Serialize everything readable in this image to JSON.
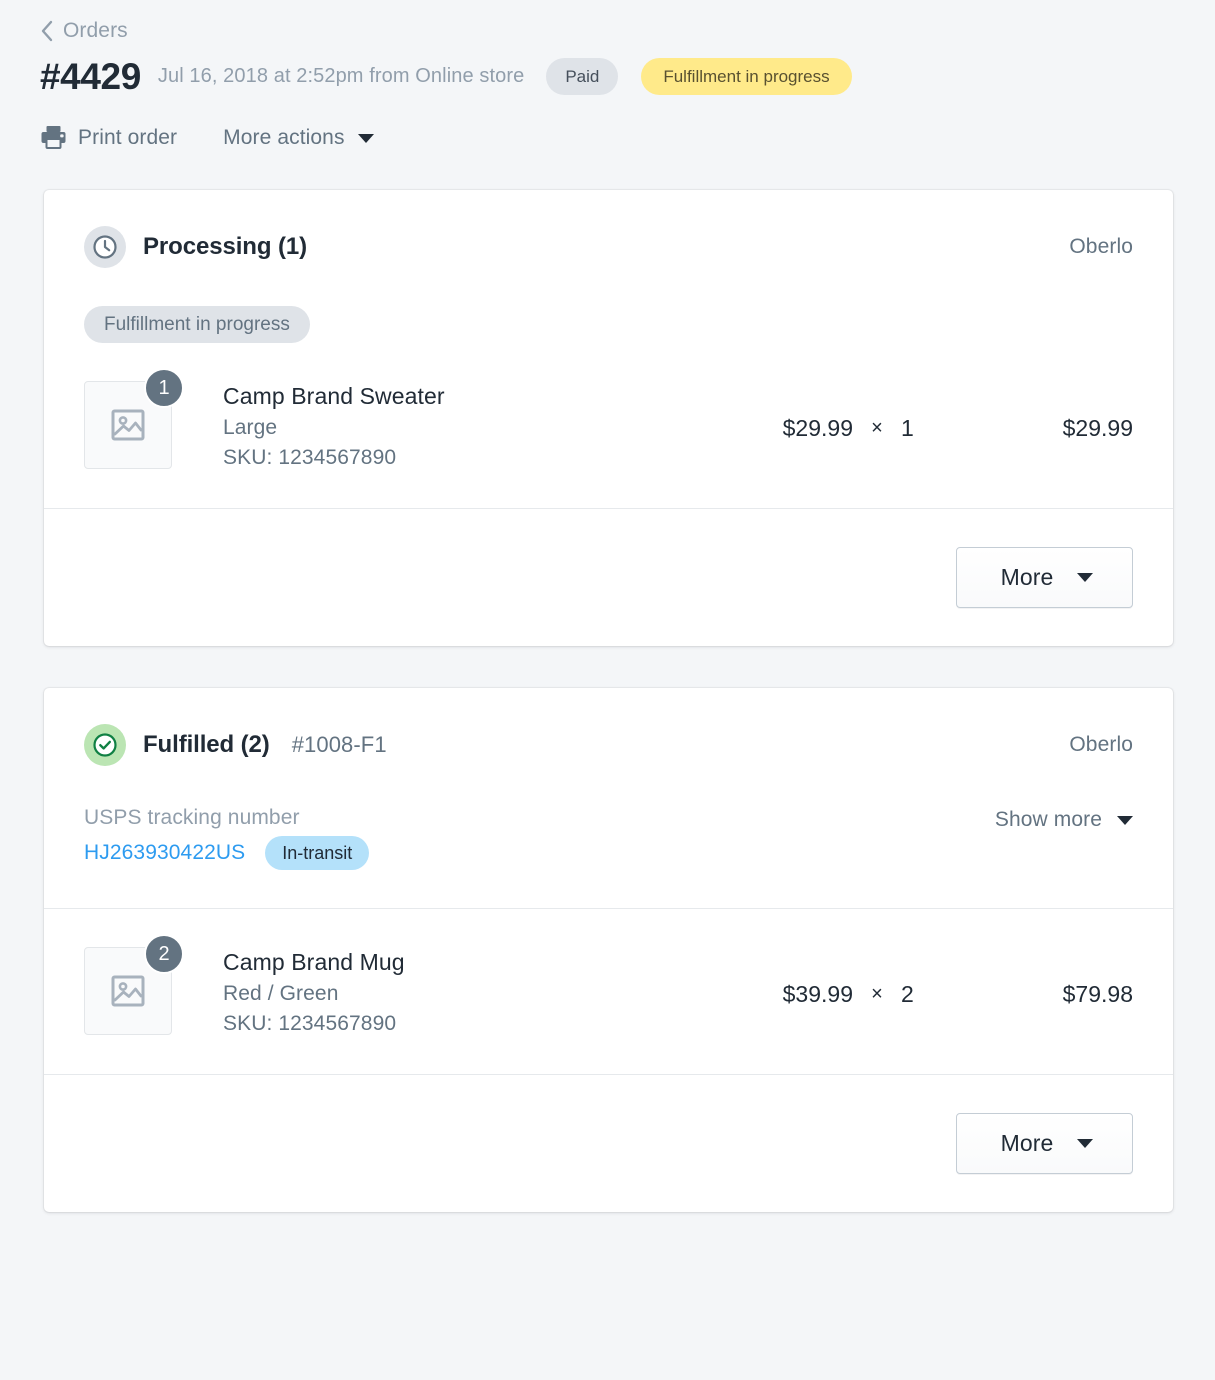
{
  "breadcrumb": {
    "label": "Orders",
    "icon": "chevron-left-icon"
  },
  "header": {
    "order_number": "#4429",
    "meta": "Jul 16, 2018 at 2:52pm from Online store",
    "payment_badge": "Paid",
    "fulfillment_badge": "Fulfillment in progress",
    "payment_badge_bg": "#dfe3e8",
    "fulfillment_badge_bg": "#ffea8a"
  },
  "actions": {
    "print_label": "Print order",
    "print_icon": "printer-icon",
    "more_actions_label": "More actions",
    "more_actions_icon": "caret-down-icon"
  },
  "cards": [
    {
      "id": "processing",
      "status_icon": "clock-icon",
      "status_icon_bg": "#dfe3e8",
      "title": "Processing (1)",
      "subtitle": "",
      "source": "Oberlo",
      "pill": "Fulfillment in progress",
      "items": [
        {
          "qty_badge": "1",
          "thumb_icon": "image-placeholder-icon",
          "title": "Camp Brand Sweater",
          "variant": "Large",
          "sku": "SKU: 1234567890",
          "unit_price": "$29.99",
          "multiplier": "×",
          "quantity": "1",
          "total": "$29.99"
        }
      ],
      "footer_button": {
        "label": "More",
        "icon": "caret-down-icon"
      }
    },
    {
      "id": "fulfilled",
      "status_icon": "check-circle-icon",
      "status_icon_bg": "#bbe5b3",
      "title": "Fulfilled (2)",
      "subtitle": "#1008-F1",
      "source": "Oberlo",
      "tracking": {
        "label": "USPS tracking number",
        "number": "HJ263930422US",
        "number_color": "#2d9bf0",
        "badge": "In-transit",
        "badge_bg": "#b4e1fa",
        "show_more_label": "Show more",
        "show_more_icon": "caret-down-icon"
      },
      "items": [
        {
          "qty_badge": "2",
          "thumb_icon": "image-placeholder-icon",
          "title": "Camp Brand Mug",
          "variant": "Red / Green",
          "sku": "SKU: 1234567890",
          "unit_price": "$39.99",
          "multiplier": "×",
          "quantity": "2",
          "total": "$79.98"
        }
      ],
      "footer_button": {
        "label": "More",
        "icon": "caret-down-icon"
      }
    }
  ]
}
